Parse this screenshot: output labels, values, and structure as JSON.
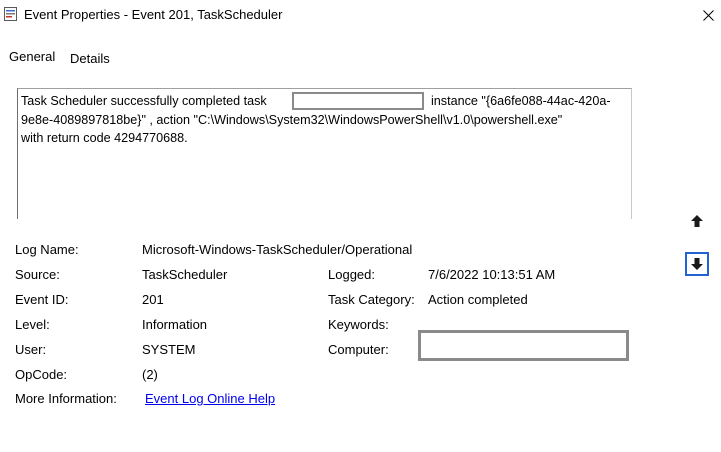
{
  "window": {
    "title": "Event Properties - Event 201, TaskScheduler",
    "icons": {
      "app": "event-viewer-icon",
      "close": "close-icon"
    }
  },
  "tabs": [
    {
      "label": "General",
      "selected": true
    },
    {
      "label": "Details",
      "selected": false
    }
  ],
  "description": {
    "line1_before": "Task Scheduler successfully completed task",
    "line1_after": "instance \"{6a6fe088-44ac-420a-",
    "line2": "9e8e-4089897818be}\" , action \"C:\\Windows\\System32\\WindowsPowerShell\\v1.0\\powershell.exe\"",
    "line3": "with return code 4294770688."
  },
  "fields": {
    "log_name": {
      "label": "Log Name:",
      "value": "Microsoft-Windows-TaskScheduler/Operational"
    },
    "source": {
      "label": "Source:",
      "value": "TaskScheduler"
    },
    "logged": {
      "label": "Logged:",
      "value": "7/6/2022 10:13:51 AM"
    },
    "event_id": {
      "label": "Event ID:",
      "value": "201"
    },
    "task_category": {
      "label": "Task Category:",
      "value": "Action completed"
    },
    "level": {
      "label": "Level:",
      "value": "Information"
    },
    "keywords": {
      "label": "Keywords:",
      "value": ""
    },
    "user": {
      "label": "User:",
      "value": "SYSTEM"
    },
    "computer": {
      "label": "Computer:",
      "value": ""
    },
    "opcode": {
      "label": "OpCode:",
      "value": "(2)"
    },
    "more_info": {
      "label": "More Information:",
      "link": "Event Log Online Help"
    }
  },
  "navigation": {
    "up_icon": "arrow-up-icon",
    "down_icon": "arrow-down-icon"
  }
}
